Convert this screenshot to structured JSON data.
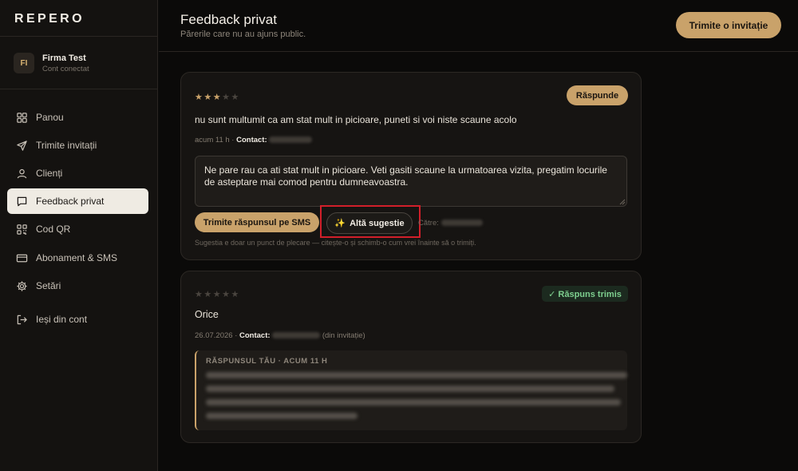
{
  "sidebar": {
    "brand": "REPERO",
    "account": {
      "initials": "FI",
      "name": "Firma Test",
      "status": "Cont conectat"
    },
    "items": [
      {
        "label": "Panou",
        "icon": "grid-icon",
        "active": false
      },
      {
        "label": "Trimite invitații",
        "icon": "send-icon",
        "active": false
      },
      {
        "label": "Clienți",
        "icon": "user-icon",
        "active": false
      },
      {
        "label": "Feedback privat",
        "icon": "chat-icon",
        "active": true
      },
      {
        "label": "Cod QR",
        "icon": "qr-icon",
        "active": false
      },
      {
        "label": "Abonament & SMS",
        "icon": "card-icon",
        "active": false
      },
      {
        "label": "Setări",
        "icon": "gear-icon",
        "active": false
      },
      {
        "label": "Ieși din cont",
        "icon": "logout-icon",
        "active": false
      }
    ]
  },
  "header": {
    "title": "Feedback privat",
    "subtitle": "Părerile care nu au ajuns public.",
    "invite_button": "Trimite o invitație"
  },
  "feedback": [
    {
      "rating": 3,
      "max_rating": 5,
      "reply_button": "Răspunde",
      "text": "nu sunt multumit ca am stat mult in picioare, puneti si voi niste scaune acolo",
      "time": "acum 11 h",
      "separator": "·",
      "contact_label": "Contact:",
      "draft_reply": "Ne pare rau ca ati stat mult in picioare. Veti gasiti scaune la urmatoarea vizita, pregatim locurile de asteptare mai comod pentru dumneavoastra.",
      "send_button": "Trimite răspunsul pe SMS",
      "suggest_button": "Altă sugestie",
      "to_label": "Către:",
      "hint": "Sugestia e doar un punct de plecare — citește-o și schimb-o cum vrei înainte să o trimiți."
    },
    {
      "rating": 0,
      "max_rating": 5,
      "status_badge": "✓ Răspuns trimis",
      "text": "Orice",
      "date": "26.07.2026",
      "separator": "·",
      "contact_label": "Contact:",
      "source": "(din invitație)",
      "your_reply_label": "RĂSPUNSUL TĂU · ACUM 11 H"
    }
  ],
  "colors": {
    "accent": "#c9a26a",
    "background": "#0b0a09",
    "sidebar": "#141210",
    "card": "#161412",
    "success": "#7ecf8f",
    "highlight": "#d11f2a"
  }
}
